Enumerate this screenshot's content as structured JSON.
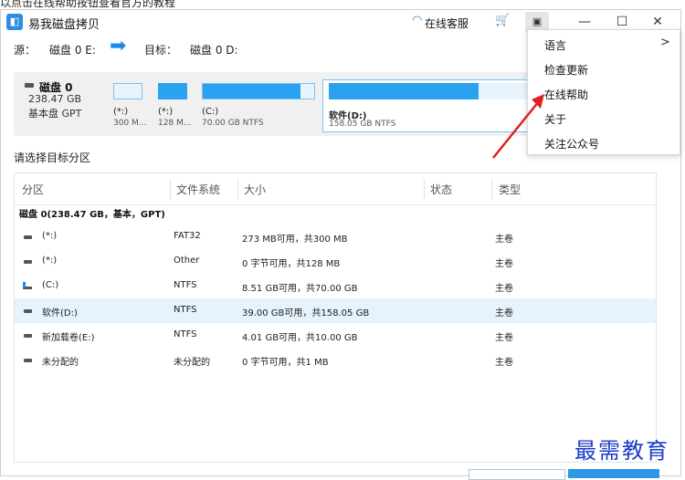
{
  "caption": "以点击在线帮助按钮查看官方的教程",
  "app": {
    "title": "易我磁盘拷贝",
    "icon": "app-logo-icon",
    "service_label": "在线客服",
    "service_icon": "headset-icon",
    "cart_icon": "cart-icon",
    "menu_icon": "menu-icon"
  },
  "window_controls": {
    "minimize": "—",
    "maximize": "☐",
    "close": "✕"
  },
  "source_row": {
    "source_label": "源：",
    "source_value": "磁盘 0 E:",
    "target_label": "目标：",
    "target_value": "磁盘 0 D:"
  },
  "disk": {
    "name": "磁盘 0",
    "size": "238.47 GB",
    "type": "基本盘 GPT",
    "partitions": [
      {
        "label": "(*:)",
        "sub": "300 M...",
        "fill": 0.0
      },
      {
        "label": "(*:)",
        "sub": "128 M...",
        "fill": 1.0
      },
      {
        "label": "(C:)",
        "sub": "70.00 GB NTFS",
        "fill": 0.88
      },
      {
        "label": "软件(D:)",
        "sub": "158.05 GB NTFS",
        "fill": 0.75
      }
    ]
  },
  "choose_label": "请选择目标分区",
  "table": {
    "headers": [
      "分区",
      "文件系统",
      "大小",
      "状态",
      "类型"
    ],
    "group": "磁盘 0(238.47 GB，基本，GPT)",
    "rows": [
      {
        "name": "(*:)",
        "fs": "FAT32",
        "size": "273 MB可用，共300 MB",
        "state": "",
        "type": "主卷"
      },
      {
        "name": "(*:)",
        "fs": "Other",
        "size": "0 字节可用，共128 MB",
        "state": "",
        "type": "主卷"
      },
      {
        "name": "(C:)",
        "fs": "NTFS",
        "size": "8.51 GB可用，共70.00 GB",
        "state": "",
        "type": "主卷"
      },
      {
        "name": "软件(D:)",
        "fs": "NTFS",
        "size": "39.00 GB可用，共158.05 GB",
        "state": "",
        "type": "主卷"
      },
      {
        "name": "新加载卷(E:)",
        "fs": "NTFS",
        "size": "4.01 GB可用，共10.00 GB",
        "state": "",
        "type": "主卷"
      },
      {
        "name": "未分配的",
        "fs": "未分配的",
        "size": "0 字节可用，共1 MB",
        "state": "",
        "type": "主卷"
      }
    ]
  },
  "menu": {
    "items": [
      {
        "label": "语言",
        "has_submenu": true
      },
      {
        "label": "检查更新",
        "has_submenu": false
      },
      {
        "label": "在线帮助",
        "has_submenu": false
      },
      {
        "label": "关于",
        "has_submenu": false
      },
      {
        "label": "关注公众号",
        "has_submenu": false
      }
    ],
    "chevron": ">"
  },
  "watermark": "最需教育",
  "colors": {
    "accent": "#2aa2f0",
    "selected_row": "#e6f2fc",
    "arrow": "#e02020",
    "watermark": "#1c3cc7"
  }
}
